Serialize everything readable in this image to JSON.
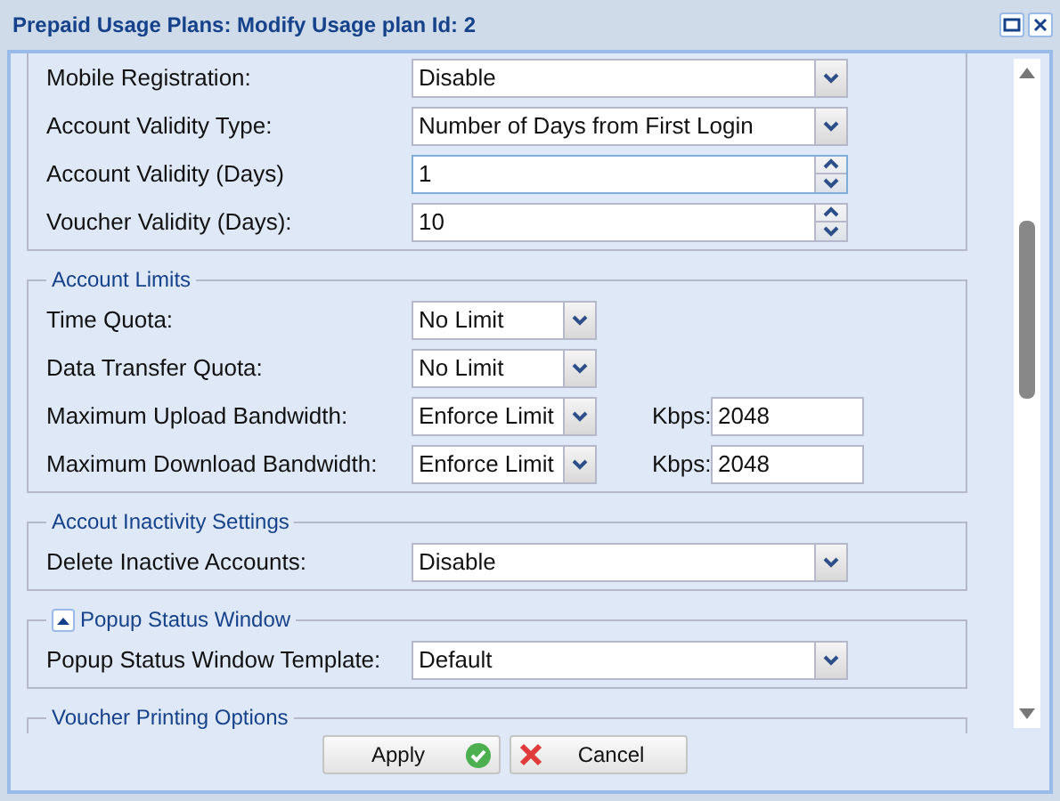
{
  "window": {
    "title": "Prepaid Usage Plans: Modify Usage plan Id: 2"
  },
  "sections": [
    {
      "rows": [
        {
          "kind": "select",
          "label": "Mobile Registration:",
          "value": "Disable"
        },
        {
          "kind": "select",
          "label": "Account Validity Type:",
          "value": "Number of Days from First Login"
        },
        {
          "kind": "spinner",
          "label": "Account Validity (Days)",
          "value": "1",
          "focused": true
        },
        {
          "kind": "spinner",
          "label": "Voucher Validity (Days):",
          "value": "10",
          "focused": false
        }
      ]
    },
    {
      "legend": "Account Limits",
      "rows": [
        {
          "kind": "short_select",
          "label": "Time Quota:",
          "value": "No Limit"
        },
        {
          "kind": "short_select",
          "label": "Data Transfer Quota:",
          "value": "No Limit"
        },
        {
          "kind": "short_select",
          "label": "Maximum Upload Bandwidth:",
          "value": "Enforce Limit",
          "unit_label": "Kbps:",
          "unit_value": "2048"
        },
        {
          "kind": "short_select",
          "label": "Maximum Download Bandwidth:",
          "value": "Enforce Limit",
          "unit_label": "Kbps:",
          "unit_value": "2048"
        }
      ]
    },
    {
      "legend": "Accout Inactivity Settings",
      "rows": [
        {
          "kind": "select",
          "label": "Delete Inactive Accounts:",
          "value": "Disable"
        }
      ]
    },
    {
      "legend": "Popup Status Window",
      "expanded": true,
      "rows": [
        {
          "kind": "select",
          "label": "Popup Status Window Template:",
          "value": "Default"
        }
      ]
    },
    {
      "legend": "Voucher Printing Options"
    }
  ],
  "buttons": [
    {
      "label": "Apply",
      "kind": "apply"
    },
    {
      "label": "Cancel",
      "kind": "cancel"
    }
  ]
}
